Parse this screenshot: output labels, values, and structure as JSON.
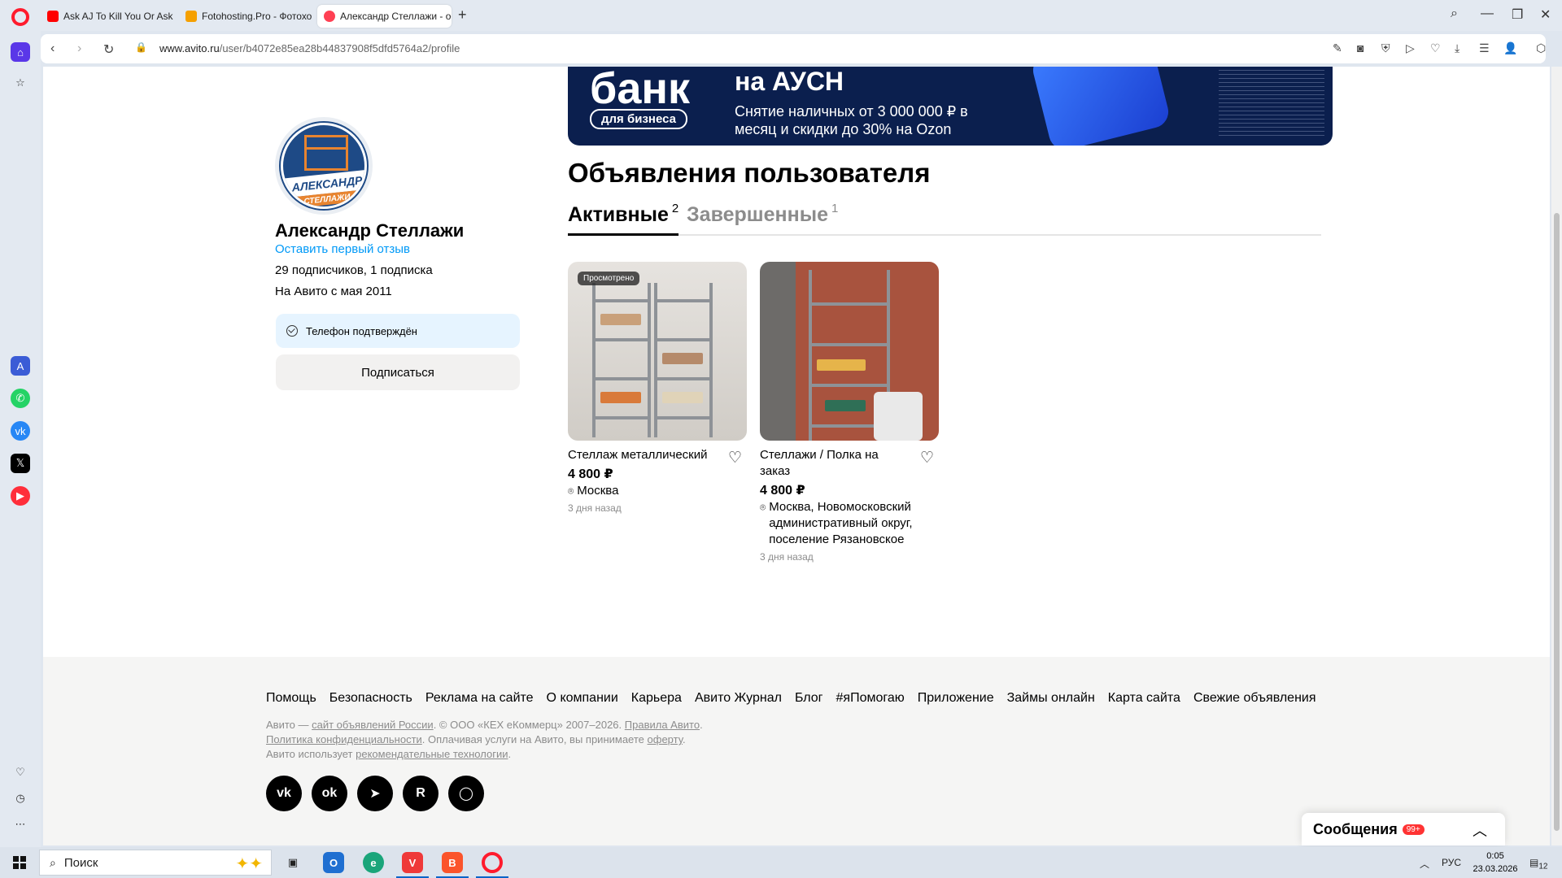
{
  "browser": {
    "tabs": [
      {
        "title": "Ask AJ To Kill You Or Ask",
        "color": "#ff0000"
      },
      {
        "title": "Fotohosting.Pro - Фотохо",
        "color": "#f5a000"
      },
      {
        "title": "Александр Стеллажи - ос",
        "color": "#ff4053"
      }
    ],
    "new_tab": "+",
    "url_host": "www.avito.ru",
    "url_path": "/user/b4072e85ea28b44837908f5dfd5764a2/profile"
  },
  "banner": {
    "brand": "банк",
    "badge": "для бизнеса",
    "headline": "на АУСН",
    "text": "Снятие наличных от 3 000 000 ₽ в месяц и скидки до 30% на Ozon",
    "phone_label": "АУСН"
  },
  "profile": {
    "avatar_line1": "АЛЕКСАНДР",
    "avatar_line2": "СТЕЛЛАЖИ",
    "name": "Александр Стеллажи",
    "review_link": "Оставить первый отзыв",
    "subscribers": "29 подписчиков, 1 подписка",
    "since": "На Авито с мая 2011",
    "phone_verified": "Телефон подтверждён",
    "subscribe_label": "Подписаться"
  },
  "listings": {
    "title": "Объявления пользователя",
    "tabs": [
      {
        "label": "Активные",
        "count": "2"
      },
      {
        "label": "Завершенные",
        "count": "1"
      }
    ],
    "items": [
      {
        "badge": "Просмотрено",
        "title": "Стеллаж металлический",
        "price": "4 800 ₽",
        "location": "Москва",
        "posted": "3 дня назад"
      },
      {
        "badge": "",
        "title": "Стеллажи / Полка на заказ",
        "price": "4 800 ₽",
        "location": "Москва, Новомосковский административный округ, поселение Рязановское",
        "posted": "3 дня назад"
      }
    ]
  },
  "footer": {
    "links": [
      "Помощь",
      "Безопасность",
      "Реклама на сайте",
      "О компании",
      "Карьера",
      "Авито Журнал",
      "Блог",
      "#яПомогаю",
      "Приложение",
      "Займы онлайн",
      "Карта сайта",
      "Свежие объявления"
    ],
    "legal": {
      "l1_a": "Авито —",
      "l1_link1": "сайт объявлений России",
      "l1_b": ". © ООО «КЕХ еКоммерц» 2007–2026.",
      "l1_link2": "Правила Авито",
      "l2_link1": "Политика конфиденциальности",
      "l2_b": ". Оплачивая услуги на Авито, вы принимаете",
      "l2_link2": "оферту",
      "l3_a": "Авито использует",
      "l3_link": "рекомендательные технологии"
    },
    "socials": [
      {
        "name": "vk",
        "glyph": "vk"
      },
      {
        "name": "ok",
        "glyph": "ok"
      },
      {
        "name": "telegram",
        "glyph": "➤"
      },
      {
        "name": "rutube",
        "glyph": "R"
      },
      {
        "name": "max",
        "glyph": "◯"
      }
    ]
  },
  "messages": {
    "label": "Сообщения",
    "badge": "99+"
  },
  "taskbar": {
    "search_placeholder": "Поиск",
    "lang": "РУС",
    "time": "0:05",
    "date": "23.03.2026",
    "notifications": "12"
  },
  "colors": {
    "link": "#0099f7",
    "verified_bg": "#e6f4ff",
    "opera_red": "#ff1b2d",
    "banner_bg": "#0b1f4e"
  }
}
